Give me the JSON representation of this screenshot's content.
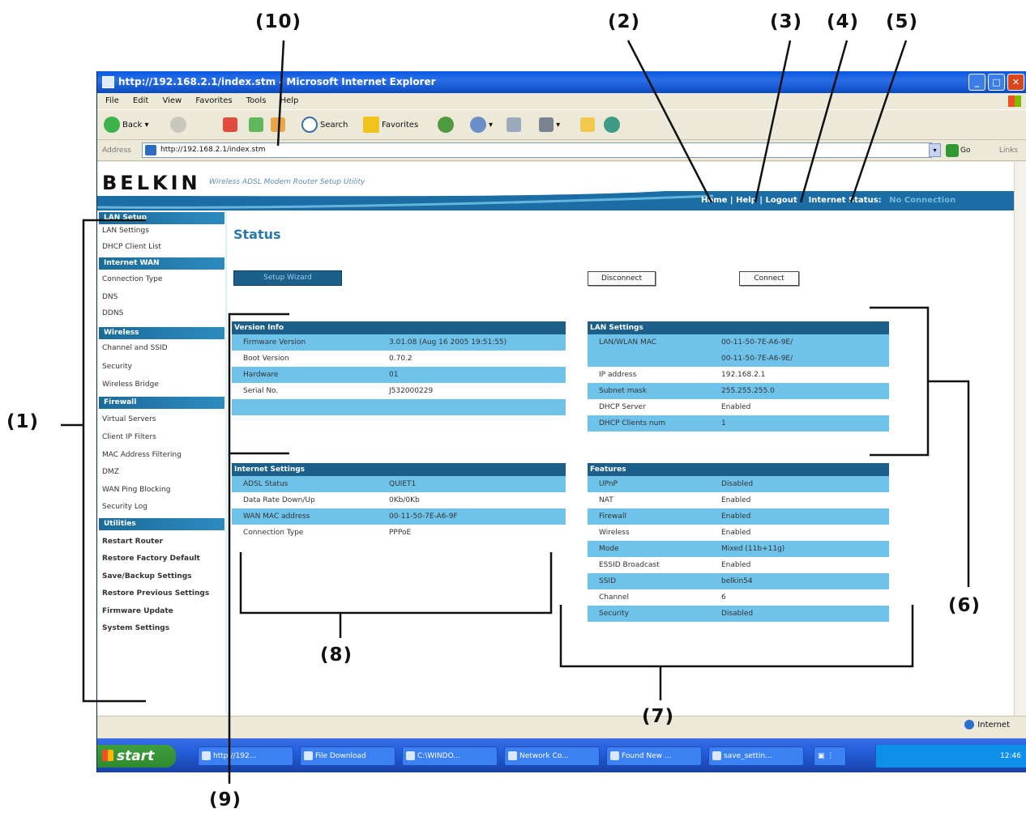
{
  "callouts": [
    "(1)",
    "(2)",
    "(3)",
    "(4)",
    "(5)",
    "(6)",
    "(7)",
    "(8)",
    "(9)",
    "(10)"
  ],
  "browser": {
    "title": "http://192.168.2.1/index.stm - Microsoft Internet Explorer",
    "menu": [
      "File",
      "Edit",
      "View",
      "Favorites",
      "Tools",
      "Help"
    ],
    "toolbar": {
      "back": "Back",
      "search": "Search",
      "favorites": "Favorites"
    },
    "address_label": "Address",
    "address_value": "http://192.168.2.1/index.stm",
    "go": "Go",
    "links": "Links",
    "status_zone": "Internet"
  },
  "router": {
    "brand": "BELKIN",
    "subtitle": "Wireless ADSL Modem Router Setup Utility",
    "header_links": {
      "home": "Home",
      "help": "Help",
      "logout": "Logout",
      "internet_status_label": "Internet Status:",
      "internet_status_value": "No Connection"
    },
    "nav": {
      "lan_setup": {
        "head": "LAN Setup",
        "items": [
          "LAN Settings",
          "DHCP Client List"
        ]
      },
      "internet_wan": {
        "head": "Internet WAN",
        "items": [
          "Connection Type",
          "DNS",
          "DDNS"
        ]
      },
      "wireless": {
        "head": "Wireless",
        "items": [
          "Channel and SSID",
          "Security",
          "Wireless Bridge"
        ]
      },
      "firewall": {
        "head": "Firewall",
        "items": [
          "Virtual Servers",
          "Client IP Filters",
          "MAC Address Filtering",
          "DMZ",
          "WAN Ping Blocking",
          "Security Log"
        ]
      },
      "utilities": {
        "head": "Utilities",
        "items": [
          "Restart Router",
          "Restore Factory Default",
          "Save/Backup Settings",
          "Restore Previous Settings",
          "Firmware Update",
          "System Settings"
        ]
      }
    },
    "page_title": "Status",
    "buttons": {
      "setup_wizard": "Setup Wizard",
      "disconnect": "Disconnect",
      "connect": "Connect"
    },
    "version_info": {
      "head": "Version Info",
      "rows": [
        {
          "k": "Firmware Version",
          "v": "3.01.08 (Aug 16 2005 19:51:55)"
        },
        {
          "k": "Boot Version",
          "v": "0.70.2"
        },
        {
          "k": "Hardware",
          "v": "01"
        },
        {
          "k": "Serial No.",
          "v": "J532000229"
        }
      ]
    },
    "lan_settings": {
      "head": "LAN Settings",
      "rows": [
        {
          "k": "LAN/WLAN MAC",
          "v": "00-11-50-7E-A6-9E/"
        },
        {
          "k": "",
          "v": "00-11-50-7E-A6-9E/"
        },
        {
          "k": "IP address",
          "v": "192.168.2.1"
        },
        {
          "k": "Subnet mask",
          "v": "255.255.255.0"
        },
        {
          "k": "DHCP Server",
          "v": "Enabled"
        },
        {
          "k": "DHCP Clients num",
          "v": "1"
        }
      ]
    },
    "internet_settings": {
      "head": "Internet Settings",
      "rows": [
        {
          "k": "ADSL Status",
          "v": "QUIET1"
        },
        {
          "k": "Data Rate Down/Up",
          "v": "0Kb/0Kb"
        },
        {
          "k": "WAN MAC address",
          "v": "00-11-50-7E-A6-9F"
        },
        {
          "k": "Connection Type",
          "v": "PPPoE"
        }
      ]
    },
    "features": {
      "head": "Features",
      "rows": [
        {
          "k": "UPnP",
          "v": "Disabled"
        },
        {
          "k": "NAT",
          "v": "Enabled"
        },
        {
          "k": "Firewall",
          "v": "Enabled"
        },
        {
          "k": "Wireless",
          "v": "Enabled"
        },
        {
          "k": "Mode",
          "v": "Mixed (11b+11g)"
        },
        {
          "k": "ESSID Broadcast",
          "v": "Enabled"
        },
        {
          "k": "SSID",
          "v": "belkin54"
        },
        {
          "k": "Channel",
          "v": "6"
        },
        {
          "k": "Security",
          "v": "Disabled"
        }
      ]
    }
  },
  "taskbar": {
    "start": "start",
    "buttons": [
      "http://192...",
      "File Download",
      "C:\\WINDO...",
      "Network Co...",
      "Found New ...",
      "save_settin..."
    ],
    "clock": "12:46"
  }
}
